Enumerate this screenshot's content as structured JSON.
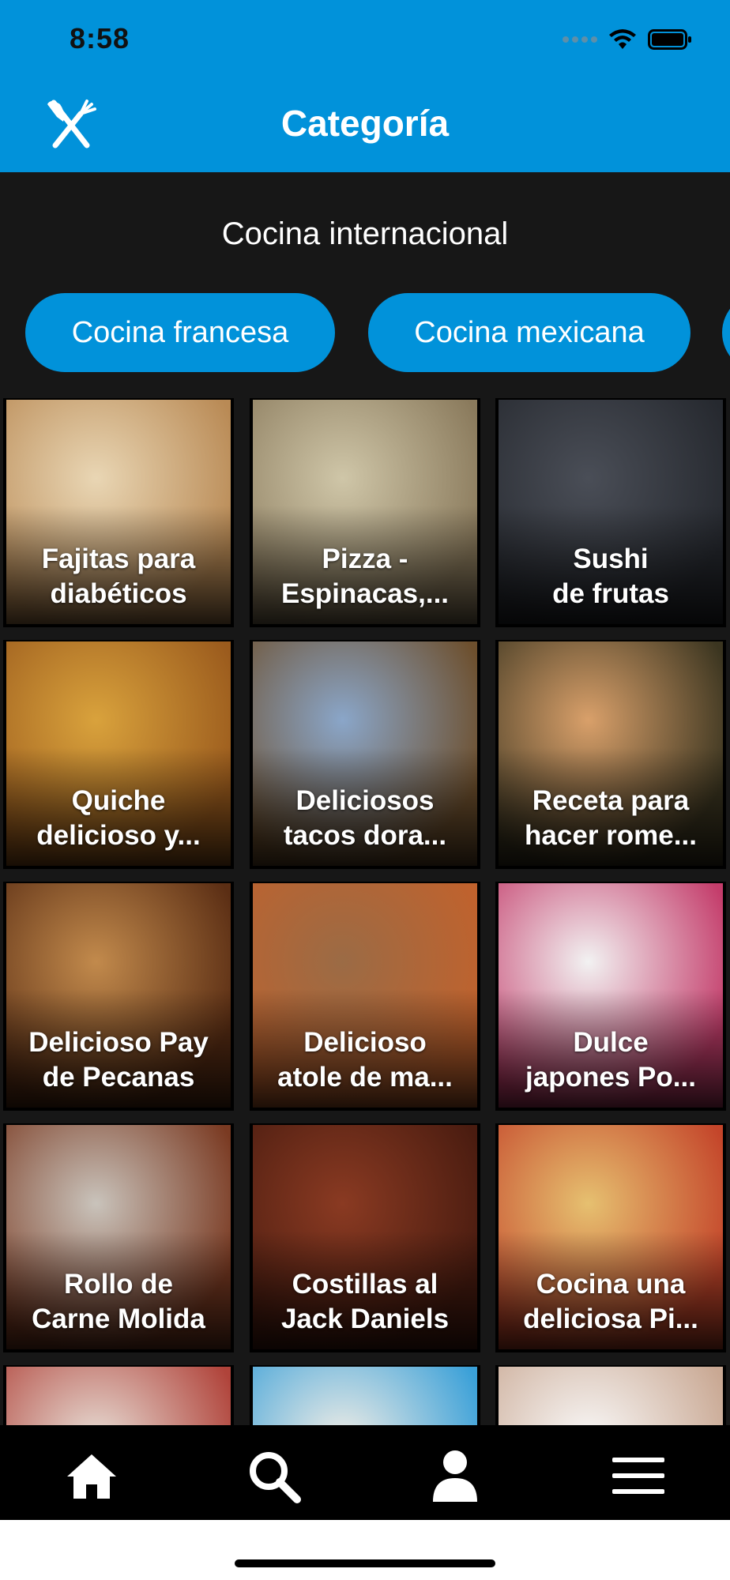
{
  "status": {
    "time": "8:58"
  },
  "header": {
    "title": "Categoría"
  },
  "section": {
    "title": "Cocina internacional"
  },
  "categories": [
    {
      "label": "Cocina francesa"
    },
    {
      "label": "Cocina mexicana"
    }
  ],
  "recipes": [
    {
      "line1": "Fajitas para",
      "line2": "diabéticos",
      "colors": [
        "#e9d6b4",
        "#b98a55"
      ]
    },
    {
      "line1": "Pizza -",
      "line2": "Espinacas,...",
      "colors": [
        "#cfc6a8",
        "#8a7a5c"
      ]
    },
    {
      "line1": "Sushi",
      "line2": "de frutas",
      "colors": [
        "#4a4e57",
        "#26292f"
      ]
    },
    {
      "line1": "Quiche",
      "line2": "delicioso y...",
      "colors": [
        "#d9a23c",
        "#9b5b1d"
      ]
    },
    {
      "line1": "Deliciosos",
      "line2": "tacos dora...",
      "colors": [
        "#8aa6c9",
        "#6d4f2d"
      ]
    },
    {
      "line1": "Receta para",
      "line2": "hacer rome...",
      "colors": [
        "#d9a06a",
        "#3b3520"
      ]
    },
    {
      "line1": "Delicioso Pay",
      "line2": "de Pecanas",
      "colors": [
        "#c28a4c",
        "#5b2e14"
      ]
    },
    {
      "line1": "Delicioso",
      "line2": "atole de ma...",
      "colors": [
        "#9b6b45",
        "#c0622d"
      ]
    },
    {
      "line1": "Dulce",
      "line2": "japones Po...",
      "colors": [
        "#f2f2f2",
        "#c43d6b"
      ]
    },
    {
      "line1": "Rollo de",
      "line2": "Carne Molida",
      "colors": [
        "#c9c3bb",
        "#7a3a22"
      ]
    },
    {
      "line1": "Costillas al",
      "line2": "Jack Daniels",
      "colors": [
        "#8a3a22",
        "#4a1c10"
      ]
    },
    {
      "line1": "Cocina una",
      "line2": "deliciosa Pi...",
      "colors": [
        "#e6c070",
        "#c4452a"
      ]
    },
    {
      "line1": "",
      "line2": "",
      "colors": [
        "#e8e0d8",
        "#b0433a"
      ]
    },
    {
      "line1": "",
      "line2": "",
      "colors": [
        "#f3eee6",
        "#3aa0d8"
      ]
    },
    {
      "line1": "",
      "line2": "",
      "colors": [
        "#fafafa",
        "#c9a893"
      ]
    }
  ],
  "tabs": [
    {
      "icon": "home-icon"
    },
    {
      "icon": "search-icon"
    },
    {
      "icon": "profile-icon"
    },
    {
      "icon": "menu-icon"
    }
  ],
  "colors": {
    "brand": "#0192DA",
    "background": "#171717"
  }
}
